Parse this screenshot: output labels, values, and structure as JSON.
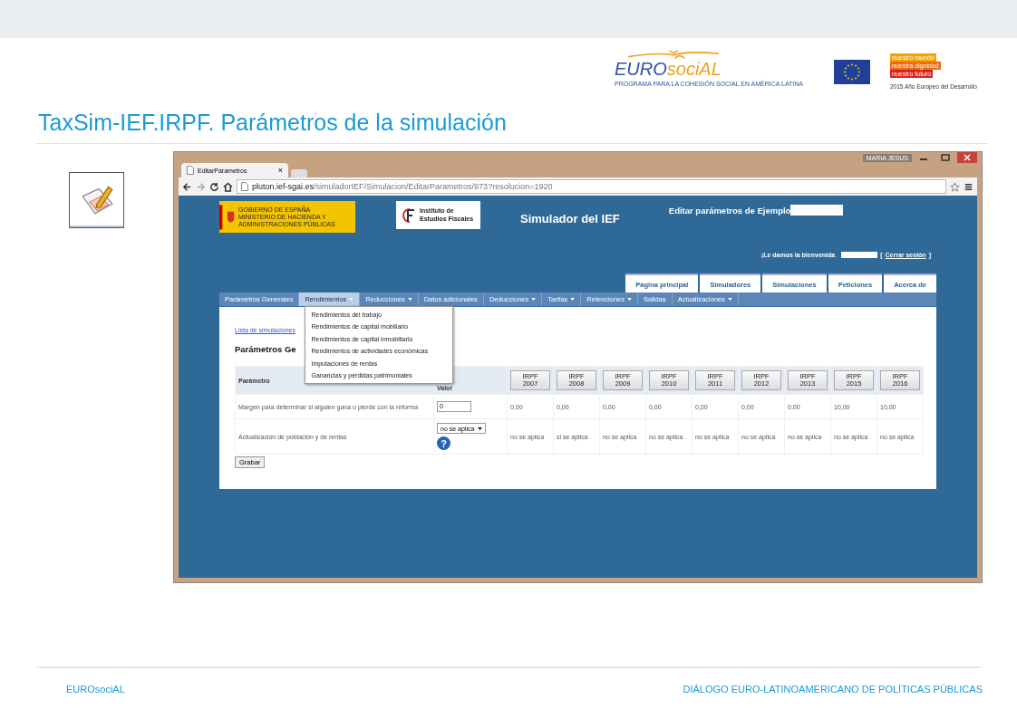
{
  "logos": {
    "eurosocial": {
      "wordmark_1": "EURO",
      "wordmark_2": "sociAL",
      "tagline": "PROGRAMA PARA LA COHESIÓN SOCIAL EN AMÉRICA LATINA"
    },
    "campaign": {
      "lines": [
        "nuestro mundo",
        "nuestra dignidad",
        "nuestro futuro"
      ],
      "caption": "2015 Año Europeo del Desarrollo"
    }
  },
  "title": "TaxSim-IEF.IRPF. Parámetros de la simulación",
  "browser": {
    "user": "MARIA JESUS",
    "tab": {
      "title": "EditarParametros",
      "close": "×"
    },
    "url": {
      "host": "pluton.ief-sgai.es",
      "path": "/simuladorIEF/Simulacion/EditarParametros/973?resolucion=1920"
    }
  },
  "page": {
    "gov_logo": {
      "line_1": "GOBIERNO DE ESPAÑA",
      "line_2": "MINISTERIO DE HACIENDA Y ADMINISTRACIONES PÚBLICAS"
    },
    "ief_logo": [
      "Instituto de",
      "Estudios Fiscales"
    ],
    "app_title": "Simulador del IEF",
    "edit_title": "Editar parámetros de Ejemplo",
    "welcome": "¡Le damos la bienvenida",
    "bracket_open": "[",
    "logout": "Cerrar sesión",
    "bracket_close": "]",
    "tabs": [
      "Página principal",
      "Simuladores",
      "Simulaciones",
      "Peticiones",
      "Acerca de"
    ],
    "menu": [
      {
        "label": "Parámetros Generales",
        "dropdown": false,
        "selected": false
      },
      {
        "label": "Rendimientos",
        "dropdown": true,
        "selected": true
      },
      {
        "label": "Reducciones",
        "dropdown": true,
        "selected": false
      },
      {
        "label": "Datos adicionales",
        "dropdown": false,
        "selected": false
      },
      {
        "label": "Deducciones",
        "dropdown": true,
        "selected": false
      },
      {
        "label": "Tarifas",
        "dropdown": true,
        "selected": false
      },
      {
        "label": "Retenciones",
        "dropdown": true,
        "selected": false
      },
      {
        "label": "Salidas",
        "dropdown": false,
        "selected": false
      },
      {
        "label": "Actualizaciones",
        "dropdown": true,
        "selected": false
      }
    ],
    "dropdown": [
      "Rendimientos del trabajo",
      "Rendimientos de capital mobiliario",
      "Rendimientos de capital inmobiliario",
      "Rendimientos de actividades económicas",
      "Imputaciones de rentas",
      "Ganancias y pérdidas patrimoniales"
    ],
    "back_link": "Lista de simulaciones",
    "heading": "Parámetros Ge",
    "table": {
      "columns": [
        "Parámetro",
        "Valor"
      ],
      "years": [
        [
          "IRPF",
          "2007"
        ],
        [
          "IRPF",
          "2008"
        ],
        [
          "IRPF",
          "2009"
        ],
        [
          "IRPF",
          "2010"
        ],
        [
          "IRPF",
          "2011"
        ],
        [
          "IRPF",
          "2012"
        ],
        [
          "IRPF",
          "2013"
        ],
        [
          "IRPF",
          "2015"
        ],
        [
          "IRPF",
          "2016"
        ]
      ],
      "rows": [
        {
          "label": "Margen para determinar si alguien gana o pierde con la reforma",
          "kind": "input",
          "value": "0",
          "cells": [
            "0,00",
            "0,00",
            "0,00",
            "0,00",
            "0,00",
            "0,00",
            "0,00",
            "10,00",
            "10,00"
          ]
        },
        {
          "label": "Actualización de población y de rentas",
          "kind": "select",
          "value": "no se aplica",
          "help": "?",
          "cells": [
            "no se aplica",
            "si se aplica",
            "no se aplica",
            "no se aplica",
            "no se aplica",
            "no se aplica",
            "no se aplica",
            "no se aplica",
            "no se aplica"
          ]
        }
      ]
    },
    "save": "Grabar"
  },
  "footer": {
    "left": "EUROsociAL",
    "right": "DIÁLOGO EURO-LATINOAMERICANO DE POLÍTICAS PÚBLICAS"
  }
}
